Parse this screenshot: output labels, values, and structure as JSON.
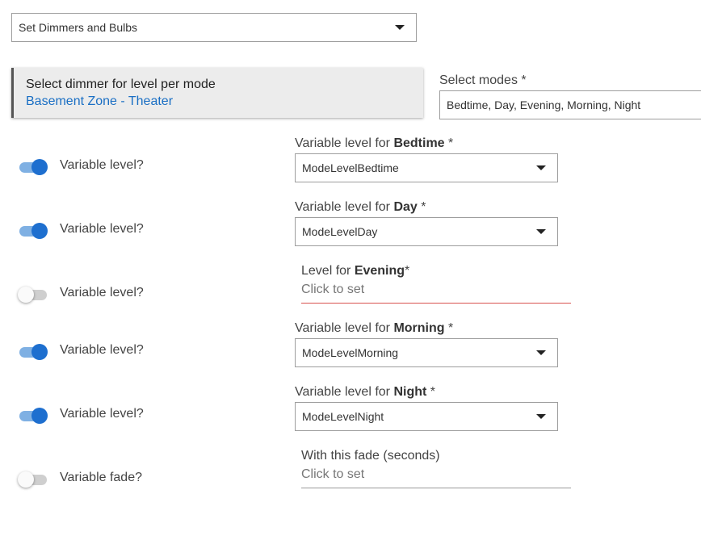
{
  "top_select": {
    "value": "Set Dimmers and Bulbs"
  },
  "panel": {
    "title": "Select dimmer for level per mode",
    "link": "Basement Zone - Theater"
  },
  "modes": {
    "label": "Select modes *",
    "value": "Bedtime, Day, Evening, Morning, Night"
  },
  "rows": [
    {
      "toggle_label": "Variable level?",
      "toggle_on": true,
      "field_prefix": "Variable level for ",
      "mode": "Bedtime",
      "suffix": " *",
      "select_value": "ModeLevelBedtime"
    },
    {
      "toggle_label": "Variable level?",
      "toggle_on": true,
      "field_prefix": "Variable level for ",
      "mode": "Day",
      "suffix": " *",
      "select_value": "ModeLevelDay"
    },
    {
      "toggle_label": "Variable level?",
      "toggle_on": false,
      "field_prefix": "Level for ",
      "mode": "Evening",
      "suffix": "*",
      "placeholder": "Click to set"
    },
    {
      "toggle_label": "Variable level?",
      "toggle_on": true,
      "field_prefix": "Variable level for ",
      "mode": "Morning",
      "suffix": " *",
      "select_value": "ModeLevelMorning"
    },
    {
      "toggle_label": "Variable level?",
      "toggle_on": true,
      "field_prefix": "Variable level for ",
      "mode": "Night",
      "suffix": " *",
      "select_value": "ModeLevelNight"
    }
  ],
  "fade": {
    "toggle_label": "Variable fade?",
    "toggle_on": false,
    "field_label": "With this fade (seconds)",
    "placeholder": "Click to set"
  },
  "colors": {
    "accent": "#1e6fcf",
    "link": "#1a6fc4",
    "error_underline": "#d9534f",
    "panel_bg": "#ececec"
  }
}
